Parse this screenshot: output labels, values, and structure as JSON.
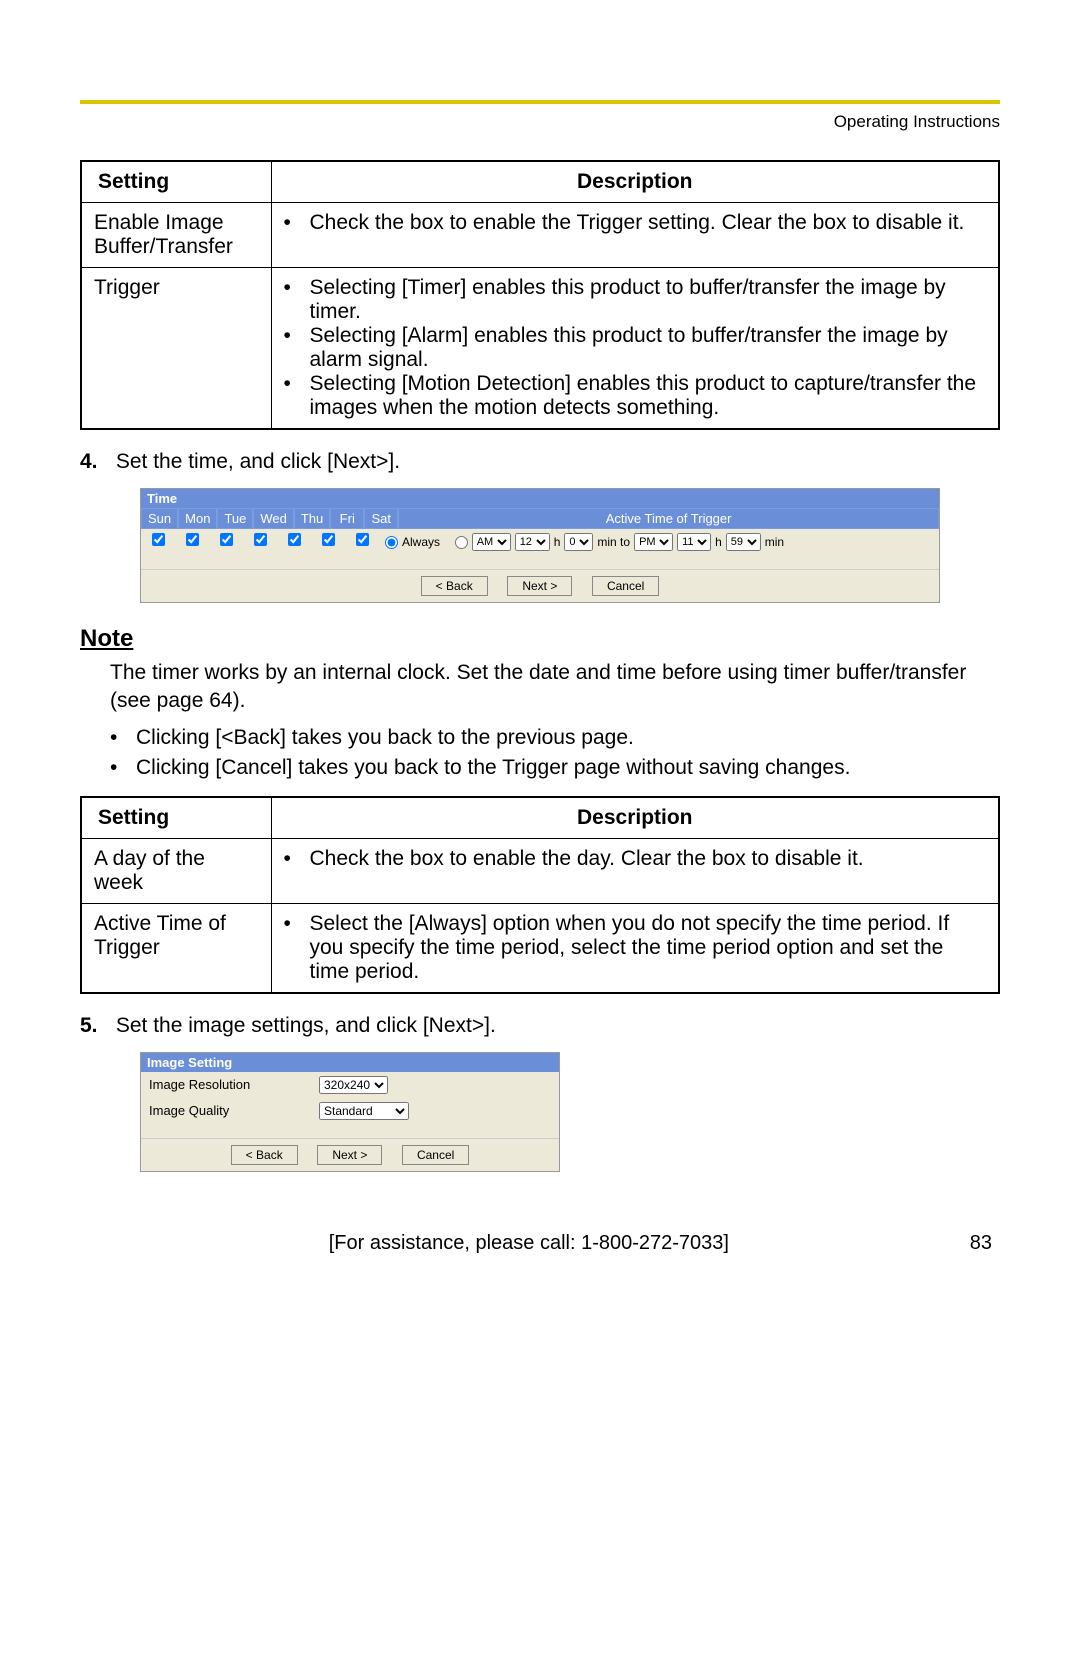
{
  "header": {
    "doc_title": "Operating Instructions"
  },
  "table1": {
    "h1": "Setting",
    "h2": "Description",
    "rows": [
      {
        "setting": "Enable Image Buffer/Transfer",
        "items": [
          "Check the box to enable the Trigger setting. Clear the box to disable it."
        ]
      },
      {
        "setting": "Trigger",
        "items": [
          "Selecting [Timer] enables this product to buffer/transfer the image by timer.",
          "Selecting [Alarm] enables this product to buffer/transfer the image by alarm signal.",
          "Selecting [Motion Detection] enables this product to capture/transfer the images when the motion detects something."
        ]
      }
    ]
  },
  "step4": {
    "num": "4.",
    "text": "Set the time, and click [Next>]."
  },
  "time_embed": {
    "title": "Time",
    "days": [
      "Sun",
      "Mon",
      "Tue",
      "Wed",
      "Thu",
      "Fri",
      "Sat"
    ],
    "active_header": "Active Time of Trigger",
    "always_label": "Always",
    "from_ampm": "AM",
    "from_ampm_opts": [
      "AM",
      "PM"
    ],
    "from_h": "12",
    "from_m": "0",
    "to_ampm": "PM",
    "to_ampm_opts": [
      "AM",
      "PM"
    ],
    "to_h": "11",
    "to_m": "59",
    "h_label": "h",
    "min_label": "min",
    "to_label": "min to",
    "back": "< Back",
    "next": "Next >",
    "cancel": "Cancel"
  },
  "note": {
    "heading": "Note",
    "body": "The timer works by an internal clock. Set the date and time before using timer buffer/transfer (see page 64).",
    "bullets": [
      "Clicking [<Back] takes you back to the previous page.",
      "Clicking [Cancel] takes you back to the Trigger page without saving changes."
    ]
  },
  "table2": {
    "h1": "Setting",
    "h2": "Description",
    "rows": [
      {
        "setting": "A day of the week",
        "items": [
          "Check the box to enable the day. Clear the box to disable it."
        ]
      },
      {
        "setting": "Active Time of Trigger",
        "items": [
          "Select the [Always] option when you do not specify the time period. If you specify the time period, select the time period option and set the time period."
        ]
      }
    ]
  },
  "step5": {
    "num": "5.",
    "text": "Set the image settings, and click [Next>]."
  },
  "img_embed": {
    "title": "Image Setting",
    "res_label": "Image Resolution",
    "res_value": "320x240",
    "qual_label": "Image Quality",
    "qual_value": "Standard",
    "back": "< Back",
    "next": "Next >",
    "cancel": "Cancel"
  },
  "footer": {
    "assist": "[For assistance, please call: 1-800-272-7033]",
    "page": "83"
  },
  "glyph": {
    "bullet": "•"
  }
}
